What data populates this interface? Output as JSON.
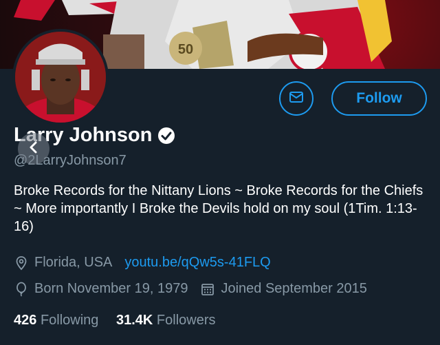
{
  "profile": {
    "name": "Larry Johnson",
    "handle": "@2LarryJohnson7",
    "bio": "Broke Records for the Nittany Lions ~ Broke Records for the Chiefs ~ More importantly I Broke the Devils hold on my soul (1Tim. 1:13-16)",
    "location": "Florida, USA",
    "website": "youtu.be/qQw5s-41FLQ",
    "birthday": "Born November 19, 1979",
    "joined": "Joined September 2015"
  },
  "actions": {
    "follow_label": "Follow"
  },
  "stats": {
    "following_count": "426",
    "following_label": "Following",
    "followers_count": "31.4K",
    "followers_label": "Followers"
  },
  "banner": {
    "jersey_patch": "50"
  },
  "colors": {
    "background": "#15202b",
    "accent": "#1d9bf0",
    "muted": "#8899a6"
  },
  "icons": [
    "mail-icon",
    "verified-badge-icon",
    "back-arrow-icon",
    "location-icon",
    "birthday-balloon-icon",
    "calendar-icon"
  ]
}
